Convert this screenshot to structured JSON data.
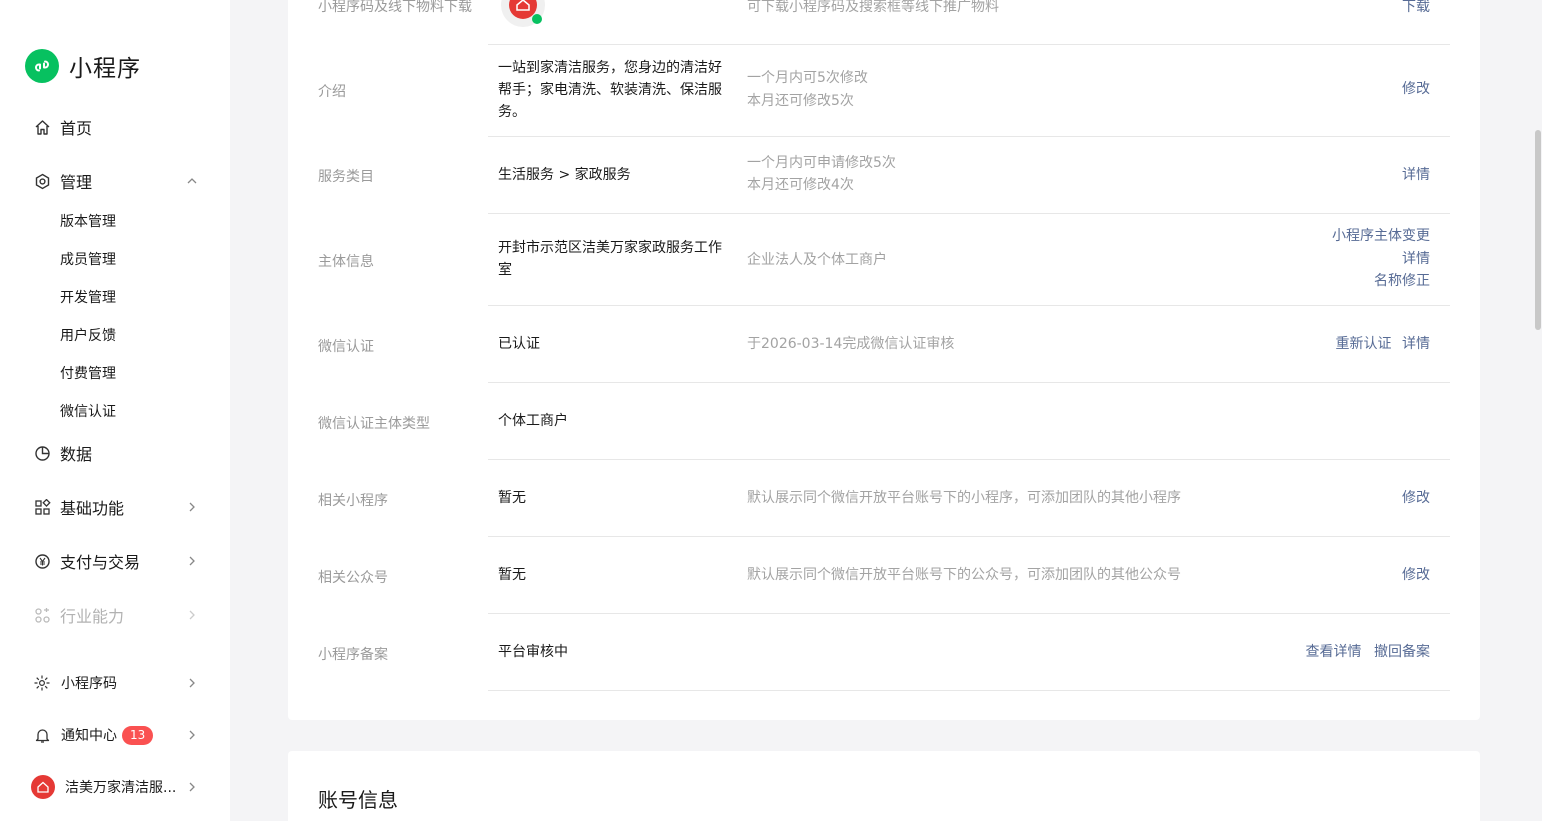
{
  "app": {
    "title": "小程序"
  },
  "nav": {
    "home": "首页",
    "manage": "管理",
    "manage_sub": [
      "版本管理",
      "成员管理",
      "开发管理",
      "用户反馈",
      "付费管理",
      "微信认证"
    ],
    "data": "数据",
    "basic": "基础功能",
    "pay": "支付与交易",
    "industry": "行业能力"
  },
  "bottom": {
    "qrcode": "小程序码",
    "notify": "通知中心",
    "notify_count": "13",
    "account": "洁美万家清洁服..."
  },
  "rows": {
    "qr": {
      "label": "小程序码及线下物料下载",
      "desc": "可下载小程序码及搜索框等线下推广物料",
      "action": "下载"
    },
    "intro": {
      "label": "介绍",
      "value": "一站到家清洁服务，您身边的清洁好帮手；家电清洗、软装清洗、保洁服务。",
      "desc1": "一个月内可5次修改",
      "desc2": "本月还可修改5次",
      "action": "修改"
    },
    "category": {
      "label": "服务类目",
      "value": "生活服务 > 家政服务",
      "desc1": "一个月内可申请修改5次",
      "desc2": "本月还可修改4次",
      "action": "详情"
    },
    "subject": {
      "label": "主体信息",
      "value": "开封市示范区洁美万家家政服务工作室",
      "desc": "企业法人及个体工商户",
      "action1": "小程序主体变更",
      "action2": "详情",
      "action3": "名称修正"
    },
    "verify": {
      "label": "微信认证",
      "value": "已认证",
      "desc": "于2026-03-14完成微信认证审核",
      "action1": "重新认证",
      "action2": "详情"
    },
    "verify_type": {
      "label": "微信认证主体类型",
      "value": "个体工商户"
    },
    "related_mp": {
      "label": "相关小程序",
      "value": "暂无",
      "desc": "默认展示同个微信开放平台账号下的小程序，可添加团队的其他小程序",
      "action": "修改"
    },
    "related_oa": {
      "label": "相关公众号",
      "value": "暂无",
      "desc": "默认展示同个微信开放平台账号下的公众号，可添加团队的其他公众号",
      "action": "修改"
    },
    "filing": {
      "label": "小程序备案",
      "value": "平台审核中",
      "action1": "查看详情",
      "action2": "撤回备案"
    }
  },
  "section2": {
    "title": "账号信息"
  },
  "colors": {
    "accent": "#07c160",
    "link": "#576b95",
    "badge": "#fa5151"
  }
}
